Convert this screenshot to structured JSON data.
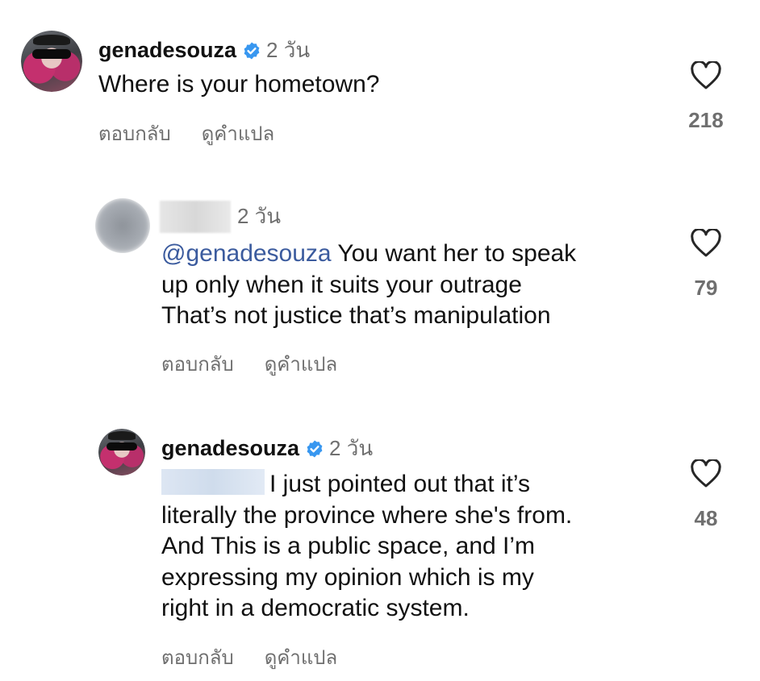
{
  "comments": [
    {
      "username": "genadesouza",
      "time": "2 วัน",
      "text": "Where is your hometown?",
      "reply_label": "ตอบกลับ",
      "translate_label": "ดูคำแปล",
      "likes": "218"
    },
    {
      "time": "2 วัน",
      "mention": "@genadesouza",
      "text_line1": " You want her to speak",
      "text_line2": "up only when it suits your outrage",
      "text_line3": "That’s not justice that’s manipulation",
      "reply_label": "ตอบกลับ",
      "translate_label": "ดูคำแปล",
      "likes": "79"
    },
    {
      "username": "genadesouza",
      "time": "2 วัน",
      "text_line1": "I just pointed out that it’s",
      "text_line2": "literally the province where she's from.",
      "text_line3": "And This is a public space, and I’m",
      "text_line4": "expressing my opinion which is my",
      "text_line5": "right in a democratic system.",
      "reply_label": "ตอบกลับ",
      "translate_label": "ดูคำแปล",
      "likes": "48"
    }
  ],
  "colors": {
    "verified": "#3897f0",
    "mention": "#3b5b9e",
    "secondary_text": "#6f6f6f"
  },
  "icons": {
    "verified": "verified-badge-icon",
    "like": "heart-outline-icon"
  }
}
